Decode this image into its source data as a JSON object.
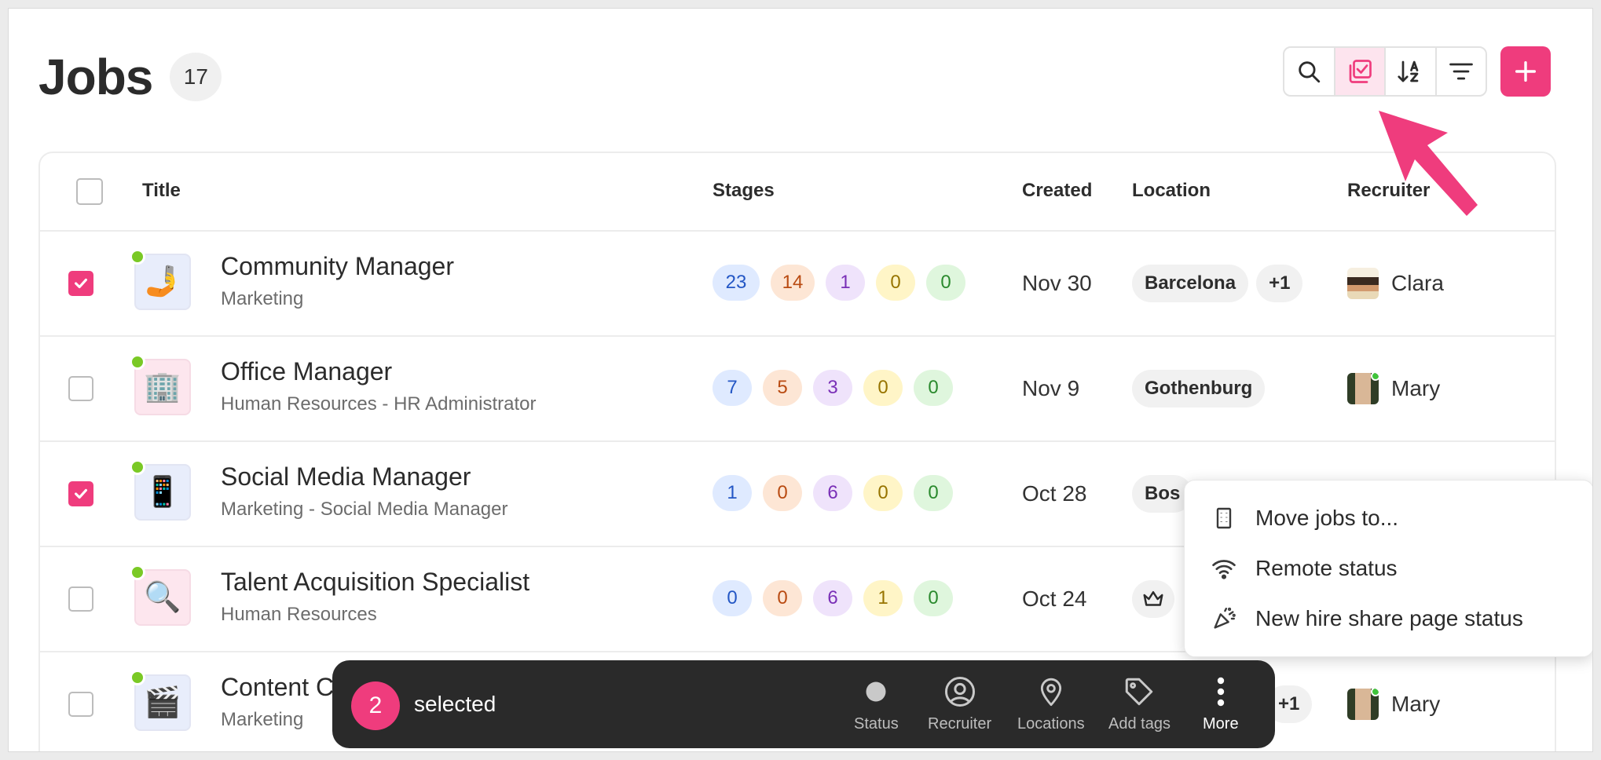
{
  "header": {
    "title": "Jobs",
    "count": "17"
  },
  "toolbar": {
    "buttons": [
      {
        "icon": "search-icon"
      },
      {
        "icon": "select-checkbox-icon",
        "active": true
      },
      {
        "icon": "sort-az-icon"
      },
      {
        "icon": "filter-icon"
      }
    ],
    "add_icon": "plus-icon",
    "accent": "#ef3c7d"
  },
  "table": {
    "headers": {
      "title": "Title",
      "stages": "Stages",
      "created": "Created",
      "location": "Location",
      "recruiter": "Recruiter"
    },
    "rows": [
      {
        "checked": true,
        "emoji": "🤳",
        "title": "Community Manager",
        "subtitle": "Marketing",
        "stages": [
          "23",
          "14",
          "1",
          "0",
          "0"
        ],
        "created": "Nov 30",
        "locations": [
          "Barcelona",
          "+1"
        ],
        "recruiter": "Clara"
      },
      {
        "checked": false,
        "emoji": "🏢",
        "title": "Office Manager",
        "subtitle": "Human Resources - HR Administrator",
        "stages": [
          "7",
          "5",
          "3",
          "0",
          "0"
        ],
        "created": "Nov 9",
        "locations": [
          "Gothenburg"
        ],
        "recruiter": "Mary"
      },
      {
        "checked": true,
        "emoji": "📱",
        "title": "Social Media Manager",
        "subtitle": "Marketing - Social Media Manager",
        "stages": [
          "1",
          "0",
          "6",
          "0",
          "0"
        ],
        "created": "Oct 28",
        "locations": [
          "Bos"
        ],
        "recruiter": ""
      },
      {
        "checked": false,
        "emoji": "🔍",
        "title": "Talent Acquisition Specialist",
        "subtitle": "Human Resources",
        "stages": [
          "0",
          "0",
          "6",
          "1",
          "0"
        ],
        "created": "Oct 24",
        "locations": [],
        "recruiter": ""
      },
      {
        "checked": false,
        "emoji": "🎬",
        "title": "Content C",
        "subtitle": "Marketing",
        "stages": [],
        "created": "",
        "locations": [
          "+1"
        ],
        "recruiter": "Mary"
      }
    ]
  },
  "menu": {
    "items": [
      {
        "label": "Move jobs to...",
        "icon": "building-icon"
      },
      {
        "label": "Remote status",
        "icon": "wifi-icon"
      },
      {
        "label": "New hire share page status",
        "icon": "party-popper-icon"
      }
    ]
  },
  "actionbar": {
    "count": "2",
    "label": "selected",
    "actions": [
      {
        "label": "Status",
        "icon": "status-dot-icon"
      },
      {
        "label": "Recruiter",
        "icon": "user-circle-icon"
      },
      {
        "label": "Locations",
        "icon": "map-pin-icon"
      },
      {
        "label": "Add tags",
        "icon": "tag-icon"
      },
      {
        "label": "More",
        "icon": "more-vertical-icon"
      }
    ]
  }
}
